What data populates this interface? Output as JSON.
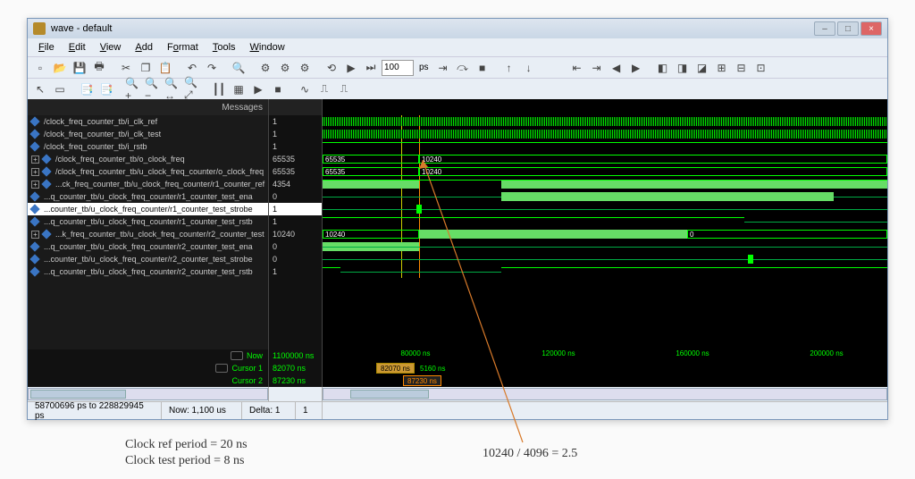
{
  "window": {
    "title": "wave - default"
  },
  "menu": {
    "file": "File",
    "edit": "Edit",
    "view": "View",
    "add": "Add",
    "format": "Format",
    "tools": "Tools",
    "window": "Window"
  },
  "toolbar": {
    "step_value": "100",
    "step_unit": "ps"
  },
  "header": {
    "messages_label": "Messages"
  },
  "signals": [
    {
      "name": "/clock_freq_counter_tb/i_clk_ref",
      "value": "1",
      "expandable": false
    },
    {
      "name": "/clock_freq_counter_tb/i_clk_test",
      "value": "1",
      "expandable": false
    },
    {
      "name": "/clock_freq_counter_tb/i_rstb",
      "value": "1",
      "expandable": false
    },
    {
      "name": "/clock_freq_counter_tb/o_clock_freq",
      "value": "65535",
      "expandable": true
    },
    {
      "name": "/clock_freq_counter_tb/u_clock_freq_counter/o_clock_freq",
      "value": "65535",
      "expandable": true
    },
    {
      "name": "...ck_freq_counter_tb/u_clock_freq_counter/r1_counter_ref",
      "value": "4354",
      "expandable": true
    },
    {
      "name": "...q_counter_tb/u_clock_freq_counter/r1_counter_test_ena",
      "value": "0",
      "expandable": false
    },
    {
      "name": "...counter_tb/u_clock_freq_counter/r1_counter_test_strobe",
      "value": "1",
      "expandable": false,
      "selected": true
    },
    {
      "name": "...q_counter_tb/u_clock_freq_counter/r1_counter_test_rstb",
      "value": "1",
      "expandable": false
    },
    {
      "name": "...k_freq_counter_tb/u_clock_freq_counter/r2_counter_test",
      "value": "10240",
      "expandable": true
    },
    {
      "name": "...q_counter_tb/u_clock_freq_counter/r2_counter_test_ena",
      "value": "0",
      "expandable": false
    },
    {
      "name": "...counter_tb/u_clock_freq_counter/r2_counter_test_strobe",
      "value": "0",
      "expandable": false
    },
    {
      "name": "...q_counter_tb/u_clock_freq_counter/r2_counter_test_rstb",
      "value": "1",
      "expandable": false
    }
  ],
  "bus_labels": {
    "clock_freq_before": "65535",
    "clock_freq_after": "10240",
    "u_clock_freq_before": "65535",
    "u_clock_freq_after": "10240",
    "r2_counter_before": "10240",
    "r2_counter_after": "0"
  },
  "cursors": {
    "now_label": "Now",
    "now_value": "1100000 ns",
    "c1_label": "Cursor 1",
    "c1_value": "82070 ns",
    "c1_box": "82070 ns",
    "c1_delta": "5160 ns",
    "c2_label": "Cursor 2",
    "c2_value": "87230 ns",
    "c2_box": "87230 ns"
  },
  "ruler": {
    "ticks": [
      "80000 ns",
      "120000 ns",
      "160000 ns",
      "200000 ns"
    ]
  },
  "status": {
    "range": "58700696 ps to 228829945 ps",
    "now": "Now: 1,100 us",
    "delta": "Delta: 1",
    "extra": "1"
  },
  "annotations": {
    "ref": "Clock ref period = 20 ns",
    "test": "Clock test period = 8 ns",
    "calc": "10240 / 4096 = 2.5"
  }
}
